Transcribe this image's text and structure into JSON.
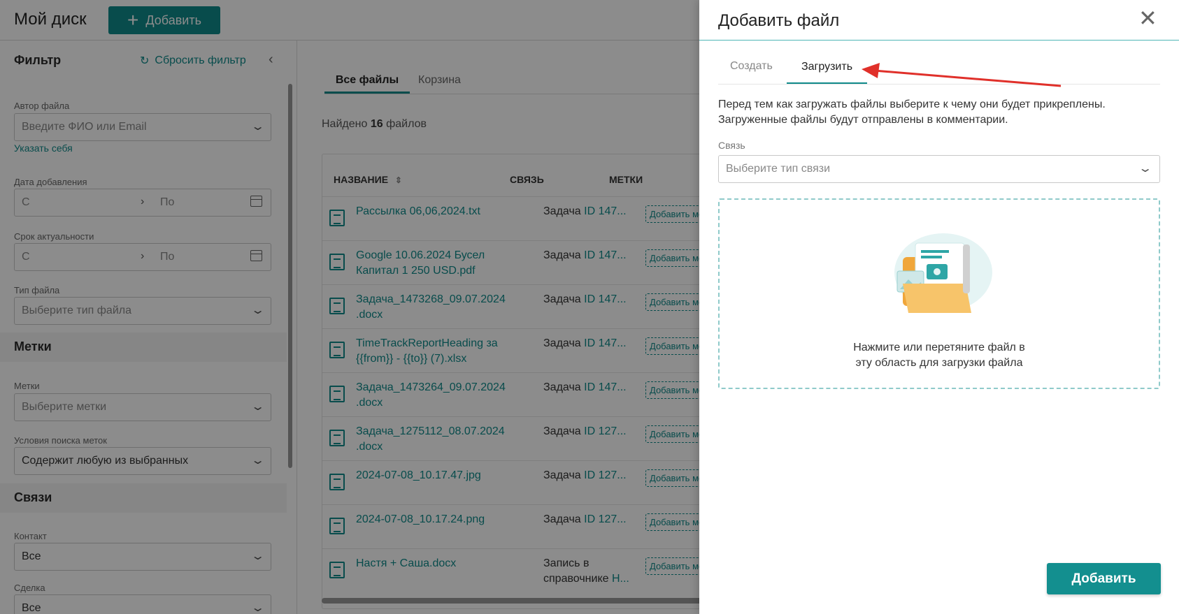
{
  "app": {
    "page_title": "Мой диск",
    "add_button_label": "Добавить"
  },
  "sidebar": {
    "filter_heading": "Фильтр",
    "reset_filter": "Сбросить фильтр",
    "author_label": "Автор файла",
    "author_placeholder": "Введите ФИО или Email",
    "self_link": "Указать себя",
    "date_added_label": "Дата добавления",
    "relevance_label": "Срок актуальности",
    "from_placeholder": "С",
    "to_placeholder": "По",
    "file_type_label": "Тип файла",
    "file_type_placeholder": "Выберите тип файла",
    "tags_heading": "Метки",
    "tags_label": "Метки",
    "tags_placeholder": "Выберите метки",
    "tag_search_label": "Условия поиска меток",
    "tag_search_value": "Содержит любую из выбранных",
    "links_heading": "Связи",
    "contact_label": "Контакт",
    "contact_value": "Все",
    "deal_label": "Сделка",
    "deal_value": "Все"
  },
  "main": {
    "tabs": [
      {
        "label": "Все файлы",
        "active": true
      },
      {
        "label": "Корзина",
        "active": false
      }
    ],
    "found_prefix": "Найдено",
    "found_count": "16",
    "found_suffix": "файлов",
    "columns": [
      "НАЗВАНИЕ",
      "СВЯЗЬ",
      "МЕТКИ"
    ],
    "rows": [
      {
        "name": "Рассылка 06,06,2024.txt",
        "relation": "Задача",
        "relation_id": "ID 147...",
        "tag": "Добавить метку"
      },
      {
        "name": "Google 10.06.2024 Бусел Капитал 1 250 USD.pdf",
        "relation": "Задача",
        "relation_id": "ID 147...",
        "tag": "Добавить метку"
      },
      {
        "name": "Задача_1473268_09.07.2024 .docx",
        "relation": "Задача",
        "relation_id": "ID 147...",
        "tag": "Добавить метку"
      },
      {
        "name": "TimeTrackReportHeading за {{from}} - {{to}} (7).xlsx",
        "relation": "Задача",
        "relation_id": "ID 147...",
        "tag": "Добавить метку"
      },
      {
        "name": "Задача_1473264_09.07.2024 .docx",
        "relation": "Задача",
        "relation_id": "ID 147...",
        "tag": "Добавить метку"
      },
      {
        "name": "Задача_1275112_08.07.2024 .docx",
        "relation": "Задача",
        "relation_id": "ID 127...",
        "tag": "Добавить метку"
      },
      {
        "name": "2024-07-08_10.17.47.jpg",
        "relation": "Задача",
        "relation_id": "ID 127...",
        "tag": "Добавить метку"
      },
      {
        "name": "2024-07-08_10.17.24.png",
        "relation": "Задача",
        "relation_id": "ID 127...",
        "tag": "Добавить метку"
      },
      {
        "name": "Настя + Саша.docx",
        "relation": "Запись в справочнике",
        "relation_id": "Н...",
        "tag": "Добавить метку"
      }
    ]
  },
  "drawer": {
    "title": "Добавить файл",
    "tabs": [
      {
        "label": "Создать",
        "active": false
      },
      {
        "label": "Загрузить",
        "active": true
      }
    ],
    "description_line1": "Перед тем как загружать файлы выберите к чему они будет прикреплены.",
    "description_line2": "Загруженные файлы будут отправлены в комментарии.",
    "relation_label": "Связь",
    "relation_placeholder": "Выберите тип связи",
    "dropzone_line1": "Нажмите или перетяните файл в",
    "dropzone_line2": "эту область для загрузки файла",
    "submit_label": "Добавить"
  },
  "colors": {
    "accent": "#0f8a8a",
    "annotation_arrow": "#e0302a",
    "overlay": "rgba(0,0,0,0.45)"
  }
}
